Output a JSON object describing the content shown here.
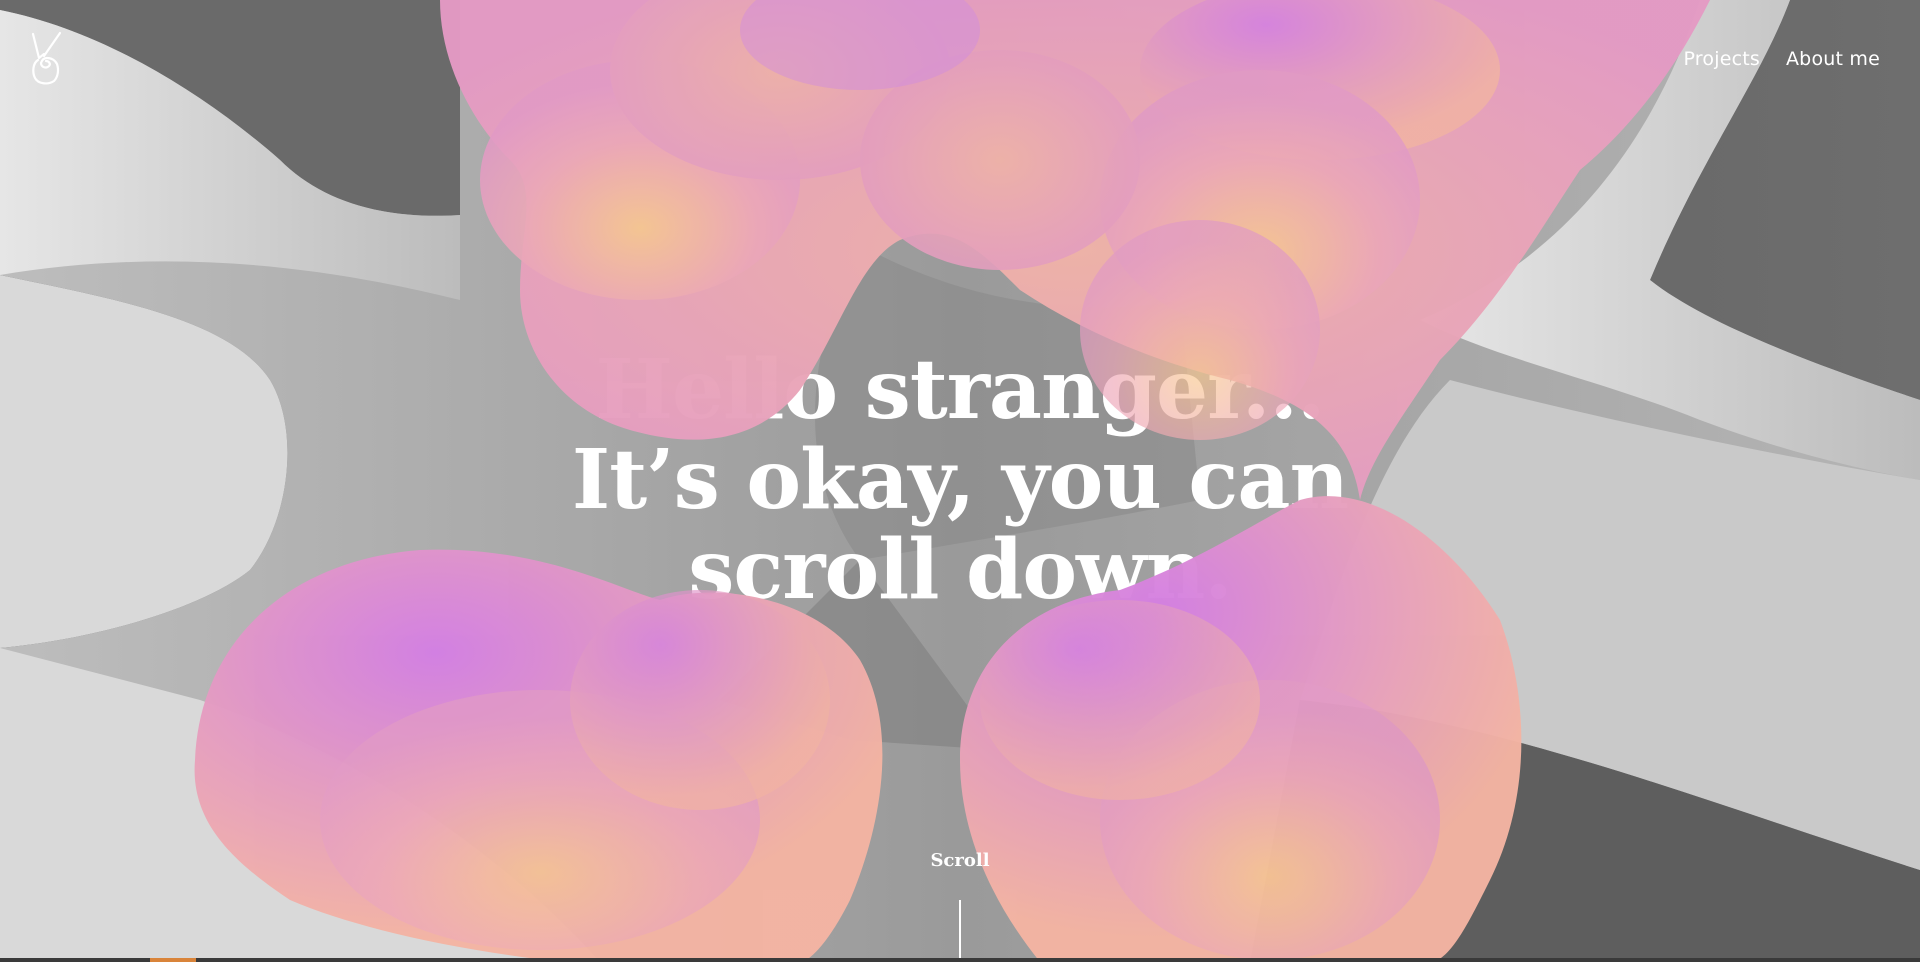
{
  "header": {
    "nav": [
      {
        "label": "Projects"
      },
      {
        "label": "About me"
      }
    ]
  },
  "hero": {
    "lines": [
      "Hello stranger...",
      "It’s okay, you can",
      "scroll down."
    ]
  },
  "scroll": {
    "label": "Scroll"
  },
  "colors": {
    "dark_gray": "#5c5c5c",
    "light_gray": "#dcdcdc",
    "blob_pink": "#e8a3c3",
    "blob_purple": "#d685e2",
    "blob_peach": "#f7c48f",
    "text": "#ffffff"
  }
}
